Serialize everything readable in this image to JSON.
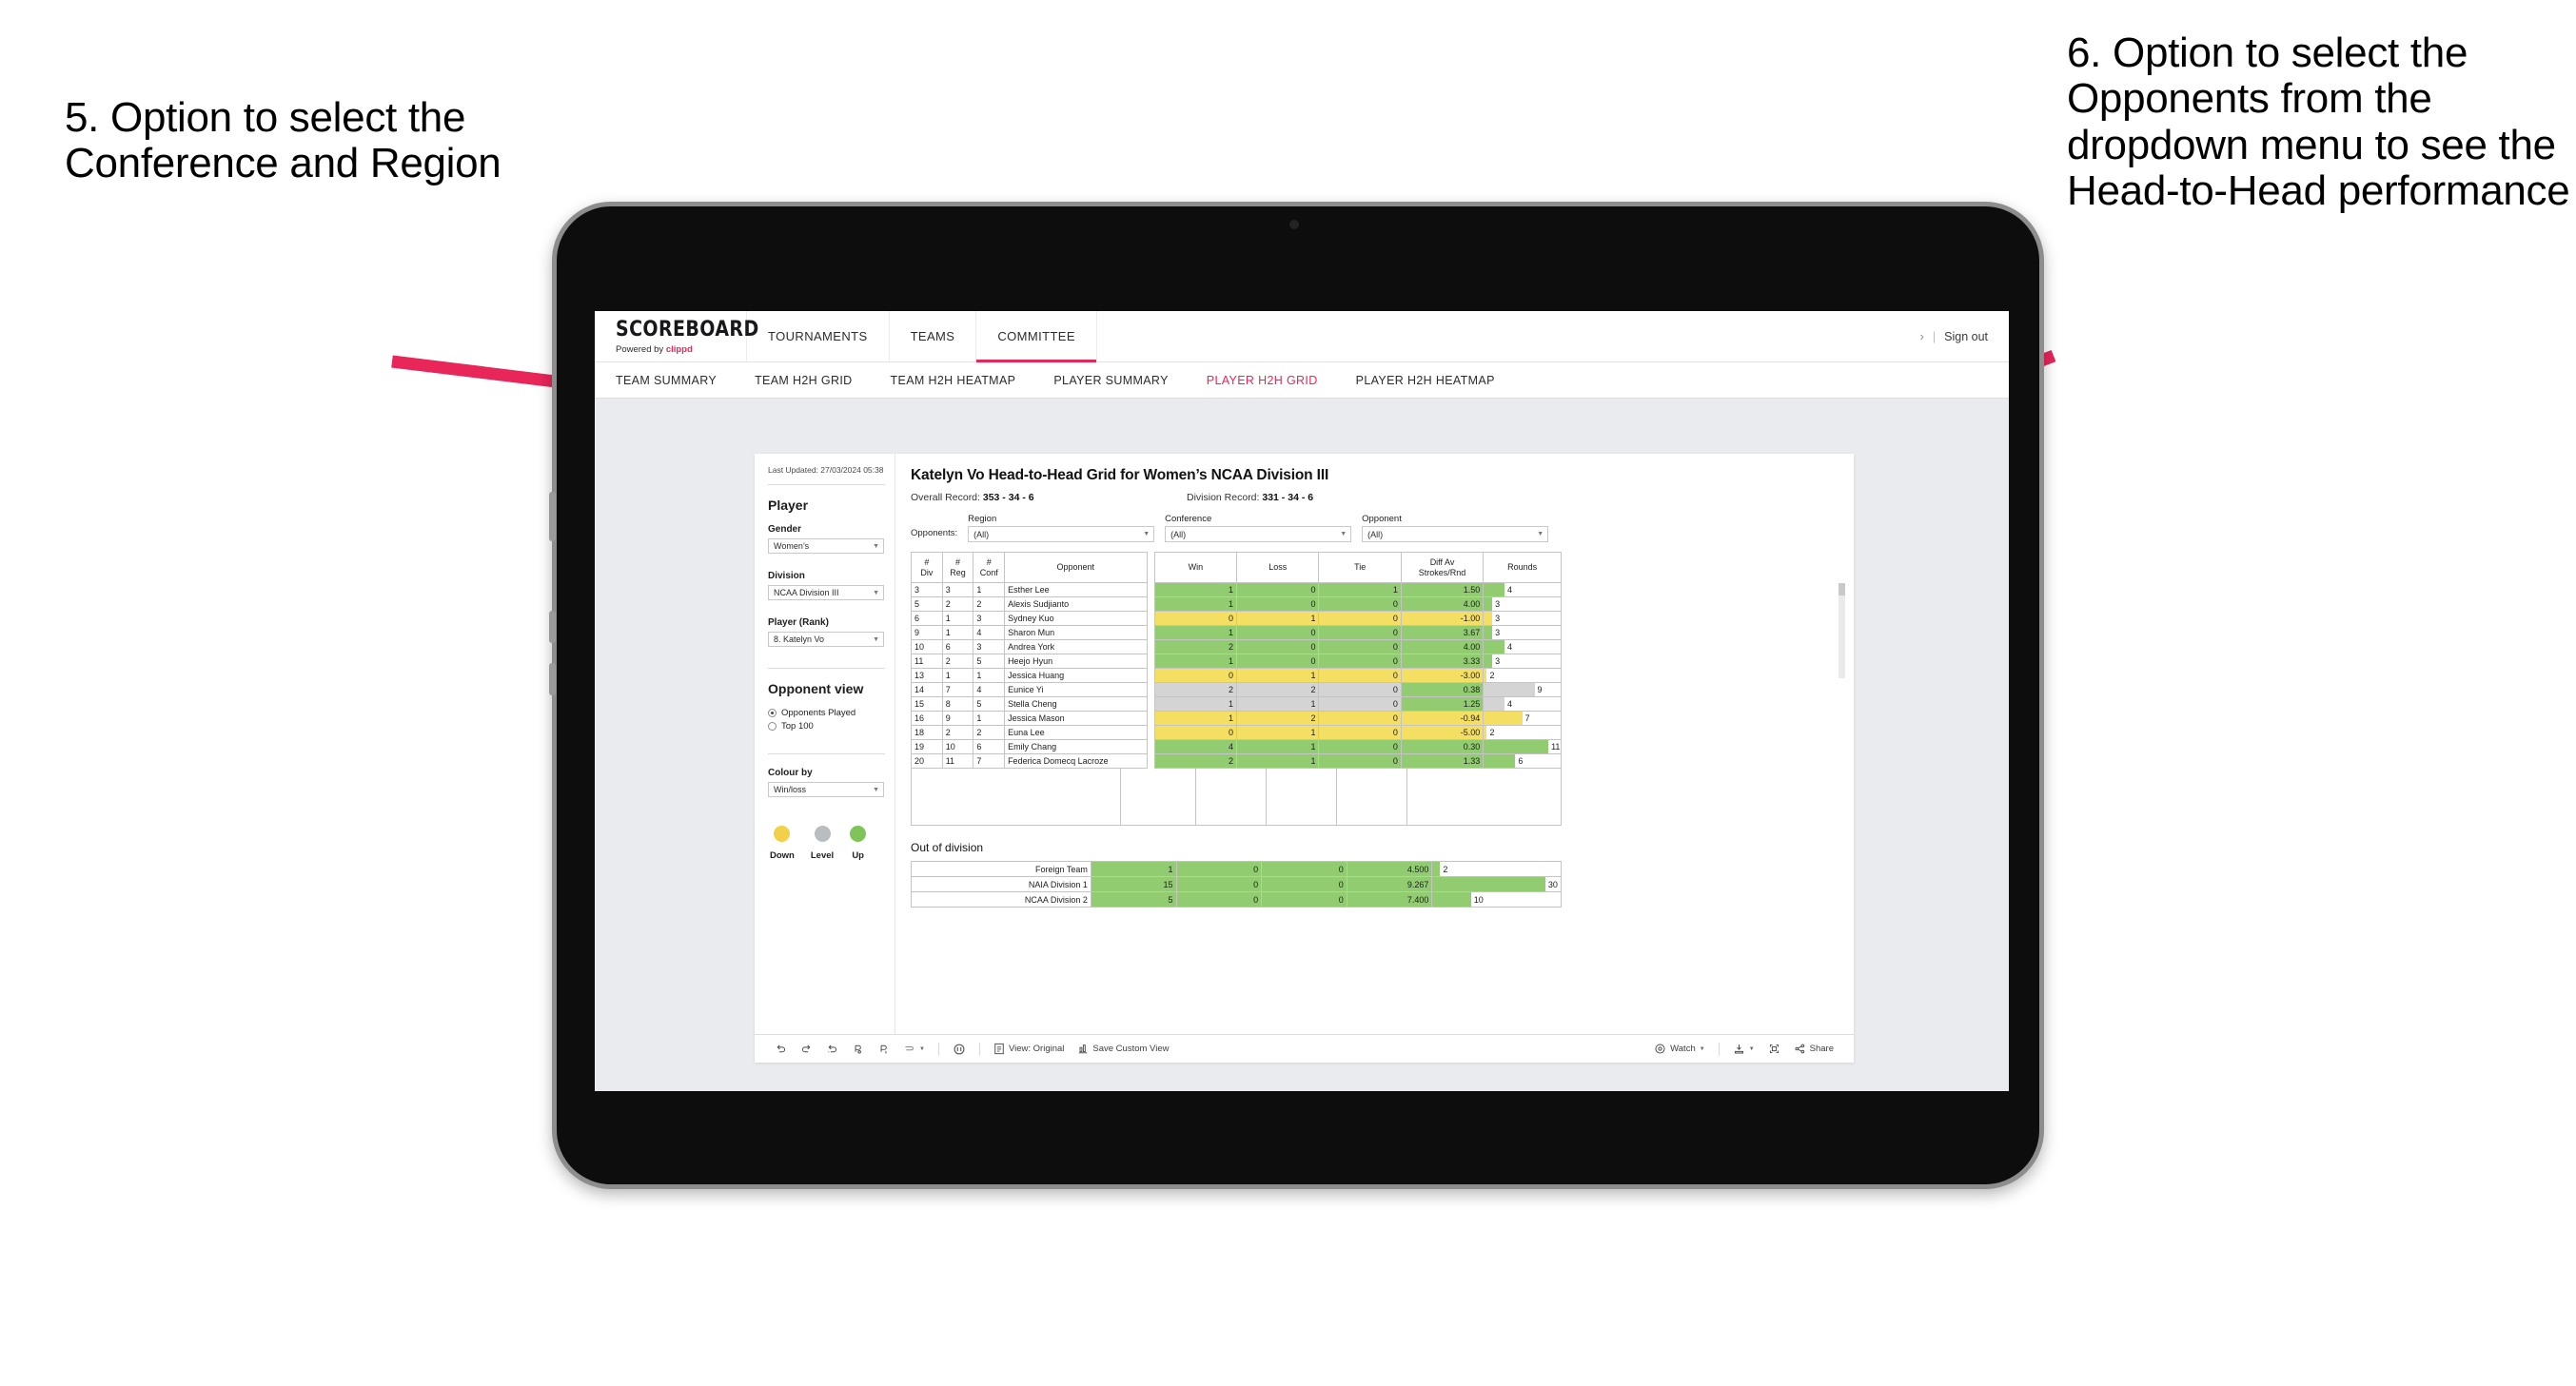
{
  "annotations": {
    "left": "5. Option to select the Conference and Region",
    "right": "6. Option to select the Opponents from the dropdown menu to see the Head-to-Head performance",
    "arrow_color": "#e8265a"
  },
  "app": {
    "logo": {
      "name": "SCOREBOARD",
      "powered_prefix": "Powered by ",
      "powered_brand": "clippd"
    },
    "topnav": [
      {
        "label": "TOURNAMENTS",
        "active": false
      },
      {
        "label": "TEAMS",
        "active": false
      },
      {
        "label": "COMMITTEE",
        "active": true
      }
    ],
    "account": {
      "glyph": "›",
      "separator": "|",
      "sign_out": "Sign out"
    },
    "subnav": [
      {
        "label": "TEAM SUMMARY",
        "active": false
      },
      {
        "label": "TEAM H2H GRID",
        "active": false
      },
      {
        "label": "TEAM H2H HEATMAP",
        "active": false
      },
      {
        "label": "PLAYER SUMMARY",
        "active": false
      },
      {
        "label": "PLAYER H2H GRID",
        "active": true
      },
      {
        "label": "PLAYER H2H HEATMAP",
        "active": false
      }
    ]
  },
  "sidebar": {
    "last_updated": "Last Updated: 27/03/2024 05:38",
    "section_player": "Player",
    "gender": {
      "label": "Gender",
      "value": "Women’s"
    },
    "division": {
      "label": "Division",
      "value": "NCAA Division III"
    },
    "player_rank": {
      "label": "Player (Rank)",
      "value": "8. Katelyn Vo"
    },
    "opponent_view": {
      "label": "Opponent view",
      "options": [
        {
          "label": "Opponents Played",
          "selected": true
        },
        {
          "label": "Top 100",
          "selected": false
        }
      ]
    },
    "colour_by": {
      "label": "Colour by",
      "value": "Win/loss"
    },
    "legend": [
      {
        "label": "Down",
        "color": "#f2d04a"
      },
      {
        "label": "Level",
        "color": "#b9bcc0"
      },
      {
        "label": "Up",
        "color": "#7ec45a"
      }
    ]
  },
  "main": {
    "title": "Katelyn Vo Head-to-Head Grid for Women’s NCAA Division III",
    "overall_record_label": "Overall Record:",
    "overall_record_value": "353 - 34 - 6",
    "division_record_label": "Division Record:",
    "division_record_value": "331 - 34 - 6",
    "opponents_label": "Opponents:",
    "filters": [
      {
        "name": "Region",
        "value": "(All)"
      },
      {
        "name": "Conference",
        "value": "(All)"
      },
      {
        "name": "Opponent",
        "value": "(All)"
      }
    ],
    "columns": [
      "# Div",
      "# Reg",
      "# Conf",
      "Opponent",
      "Win",
      "Loss",
      "Tie",
      "Diff Av Strokes/Rnd",
      "Rounds"
    ],
    "rows": [
      {
        "div": "3",
        "reg": "3",
        "conf": "1",
        "opponent": "Esther Lee",
        "win": "1",
        "loss": "0",
        "tie": "1",
        "diff": "1.50",
        "rounds": "4",
        "fill": "#91cd70",
        "diff_fill": "#91cd70",
        "bar_pct": 27
      },
      {
        "div": "5",
        "reg": "2",
        "conf": "2",
        "opponent": "Alexis Sudjianto",
        "win": "1",
        "loss": "0",
        "tie": "0",
        "diff": "4.00",
        "rounds": "3",
        "fill": "#91cd70",
        "diff_fill": "#91cd70",
        "bar_pct": 11
      },
      {
        "div": "6",
        "reg": "1",
        "conf": "3",
        "opponent": "Sydney Kuo",
        "win": "0",
        "loss": "1",
        "tie": "0",
        "diff": "-1.00",
        "rounds": "3",
        "fill": "#f5df63",
        "diff_fill": "#f5df63",
        "bar_pct": 11
      },
      {
        "div": "9",
        "reg": "1",
        "conf": "4",
        "opponent": "Sharon Mun",
        "win": "1",
        "loss": "0",
        "tie": "0",
        "diff": "3.67",
        "rounds": "3",
        "fill": "#91cd70",
        "diff_fill": "#91cd70",
        "bar_pct": 11
      },
      {
        "div": "10",
        "reg": "6",
        "conf": "3",
        "opponent": "Andrea York",
        "win": "2",
        "loss": "0",
        "tie": "0",
        "diff": "4.00",
        "rounds": "4",
        "fill": "#91cd70",
        "diff_fill": "#91cd70",
        "bar_pct": 27
      },
      {
        "div": "11",
        "reg": "2",
        "conf": "5",
        "opponent": "Heejo Hyun",
        "win": "1",
        "loss": "0",
        "tie": "0",
        "diff": "3.33",
        "rounds": "3",
        "fill": "#91cd70",
        "diff_fill": "#91cd70",
        "bar_pct": 11
      },
      {
        "div": "13",
        "reg": "1",
        "conf": "1",
        "opponent": "Jessica Huang",
        "win": "0",
        "loss": "1",
        "tie": "0",
        "diff": "-3.00",
        "rounds": "2",
        "fill": "#f5df63",
        "diff_fill": "#f5df63",
        "bar_pct": 4
      },
      {
        "div": "14",
        "reg": "7",
        "conf": "4",
        "opponent": "Eunice Yi",
        "win": "2",
        "loss": "2",
        "tie": "0",
        "diff": "0.38",
        "rounds": "9",
        "fill": "#d4d4d4",
        "diff_fill": "#91cd70",
        "bar_pct": 66
      },
      {
        "div": "15",
        "reg": "8",
        "conf": "5",
        "opponent": "Stella Cheng",
        "win": "1",
        "loss": "1",
        "tie": "0",
        "diff": "1.25",
        "rounds": "4",
        "fill": "#d4d4d4",
        "diff_fill": "#91cd70",
        "bar_pct": 27
      },
      {
        "div": "16",
        "reg": "9",
        "conf": "1",
        "opponent": "Jessica Mason",
        "win": "1",
        "loss": "2",
        "tie": "0",
        "diff": "-0.94",
        "rounds": "7",
        "fill": "#f5df63",
        "diff_fill": "#f5df63",
        "bar_pct": 50
      },
      {
        "div": "18",
        "reg": "2",
        "conf": "2",
        "opponent": "Euna Lee",
        "win": "0",
        "loss": "1",
        "tie": "0",
        "diff": "-5.00",
        "rounds": "2",
        "fill": "#f5df63",
        "diff_fill": "#f5df63",
        "bar_pct": 4
      },
      {
        "div": "19",
        "reg": "10",
        "conf": "6",
        "opponent": "Emily Chang",
        "win": "4",
        "loss": "1",
        "tie": "0",
        "diff": "0.30",
        "rounds": "11",
        "fill": "#91cd70",
        "diff_fill": "#91cd70",
        "bar_pct": 84
      },
      {
        "div": "20",
        "reg": "11",
        "conf": "7",
        "opponent": "Federica Domecq Lacroze",
        "win": "2",
        "loss": "1",
        "tie": "0",
        "diff": "1.33",
        "rounds": "6",
        "fill": "#91cd70",
        "diff_fill": "#91cd70",
        "bar_pct": 41
      }
    ],
    "out_of_division": {
      "title": "Out of division",
      "rows": [
        {
          "name": "Foreign Team",
          "win": "1",
          "loss": "0",
          "tie": "0",
          "diff": "4.500",
          "rounds": "2",
          "fill": "#91cd70",
          "bar_pct": 6
        },
        {
          "name": "NAIA Division 1",
          "win": "15",
          "loss": "0",
          "tie": "0",
          "diff": "9.267",
          "rounds": "30",
          "fill": "#91cd70",
          "bar_pct": 88
        },
        {
          "name": "NCAA Division 2",
          "win": "5",
          "loss": "0",
          "tie": "0",
          "diff": "7.400",
          "rounds": "10",
          "fill": "#91cd70",
          "bar_pct": 30
        }
      ]
    }
  },
  "toolbar": {
    "view_label": "View: Original",
    "save_label": "Save Custom View",
    "watch_label": "Watch",
    "share_label": "Share"
  }
}
